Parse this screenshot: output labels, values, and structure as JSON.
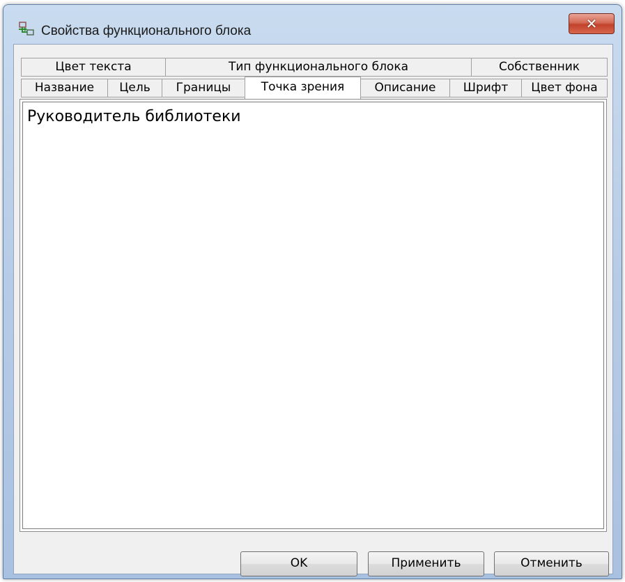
{
  "window": {
    "title": "Свойства функционального блока",
    "icon": "app-icon",
    "close_label": "✕"
  },
  "tabs": {
    "row_back": [
      {
        "label": "Цвет текста"
      },
      {
        "label": "Тип функционального блока"
      },
      {
        "label": "Собственник"
      }
    ],
    "row_front": [
      {
        "label": "Название"
      },
      {
        "label": "Цель"
      },
      {
        "label": "Границы"
      },
      {
        "label": "Точка зрения",
        "active": true
      },
      {
        "label": "Описание"
      },
      {
        "label": "Шрифт"
      },
      {
        "label": "Цвет фона"
      }
    ]
  },
  "content": {
    "text": "Руководитель библиотеки"
  },
  "buttons": {
    "ok": "OK",
    "apply": "Применить",
    "cancel": "Отменить"
  }
}
